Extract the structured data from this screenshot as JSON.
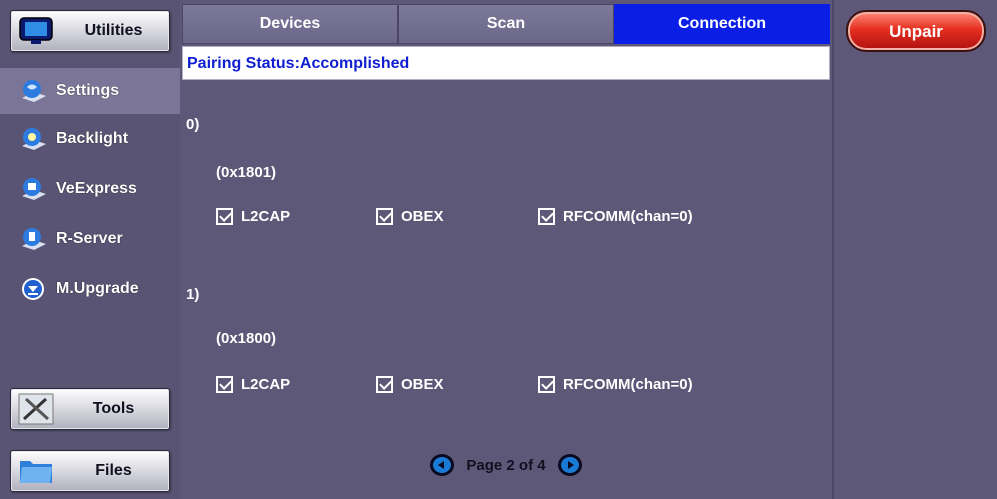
{
  "sidebar": {
    "utilities_label": "Utilities",
    "items": [
      {
        "label": "Settings",
        "icon": "settings-icon"
      },
      {
        "label": "Backlight",
        "icon": "backlight-icon"
      },
      {
        "label": "VeExpress",
        "icon": "veexpress-icon"
      },
      {
        "label": "R-Server",
        "icon": "r-server-icon"
      },
      {
        "label": "M.Upgrade",
        "icon": "upgrade-icon"
      }
    ],
    "tools_label": "Tools",
    "files_label": "Files"
  },
  "tabs": [
    {
      "label": "Devices",
      "active": false
    },
    {
      "label": "Scan",
      "active": false
    },
    {
      "label": "Connection",
      "active": true
    }
  ],
  "status": "Pairing Status:Accomplished",
  "services": [
    {
      "index": "0)",
      "uuid": "(0x1801)",
      "protocols": [
        "L2CAP",
        "OBEX",
        "RFCOMM(chan=0)"
      ]
    },
    {
      "index": "1)",
      "uuid": "(0x1800)",
      "protocols": [
        "L2CAP",
        "OBEX",
        "RFCOMM(chan=0)"
      ]
    }
  ],
  "pager": {
    "text": "Page 2 of 4"
  },
  "unpair_label": "Unpair",
  "colors": {
    "active_tab": "#0a1ee6",
    "unpair": "#e53020",
    "status_text": "#1020d0",
    "background": "#5e5878"
  }
}
